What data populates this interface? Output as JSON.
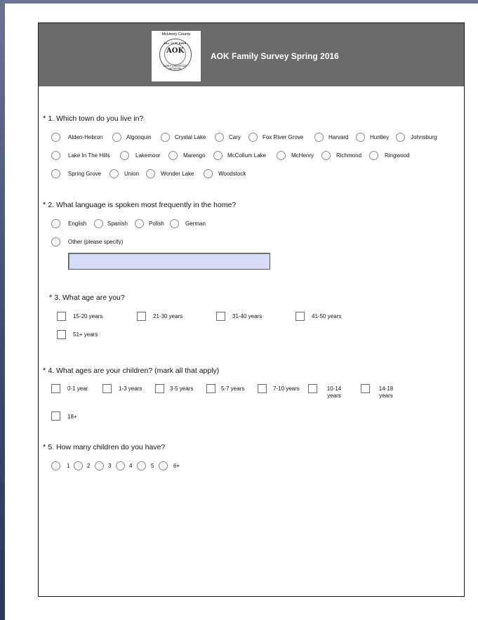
{
  "header": {
    "title": "AOK Family Survey Spring 2016",
    "logo_county": "McHenry County",
    "logo_arc": "ALL OUR KIDS",
    "logo_blocks": "AOK",
    "logo_bottom": "EARLY CHILDHOOD NETWORK"
  },
  "q1": {
    "number": "* ",
    "text": "1. Which town do you live in?",
    "options": [
      "Alden-Hebron",
      "Algonquin",
      "Crystal Lake",
      "Cary",
      "Fox River Grove",
      "Harvard",
      "Huntley",
      "Johnsburg",
      "Lake In The Hills",
      "Lakemoor",
      "Marengo",
      "McCollum Lake",
      "McHenry",
      "Richmond",
      "Ringwood",
      "Spring Grove",
      "Union",
      "Wonder Lake",
      "Woodstock"
    ]
  },
  "q2": {
    "number": "* ",
    "text": "2. What language is spoken most frequently in the home?",
    "options": [
      "English",
      "Spanish",
      "Polish",
      "German",
      "Other (please specify)"
    ],
    "other_value": ""
  },
  "q3": {
    "number": "* ",
    "text": "3. What age are you?",
    "options": [
      "15-20 years",
      "21-30 years",
      "31-40 years",
      "41-50 years",
      "51+ years"
    ]
  },
  "q4": {
    "number": "* ",
    "text": "4. What ages are your children? (mark all that apply)",
    "options": [
      "0-1 year",
      "1-3 years",
      "3-5 years",
      "5-7 years",
      "7-10 years",
      "10-14",
      "14-18",
      "18+"
    ],
    "years_word": "years"
  },
  "q5": {
    "number": "* ",
    "text": "5. How many children do you have?",
    "options": [
      "1",
      "2",
      "3",
      "4",
      "5",
      "6+"
    ]
  }
}
